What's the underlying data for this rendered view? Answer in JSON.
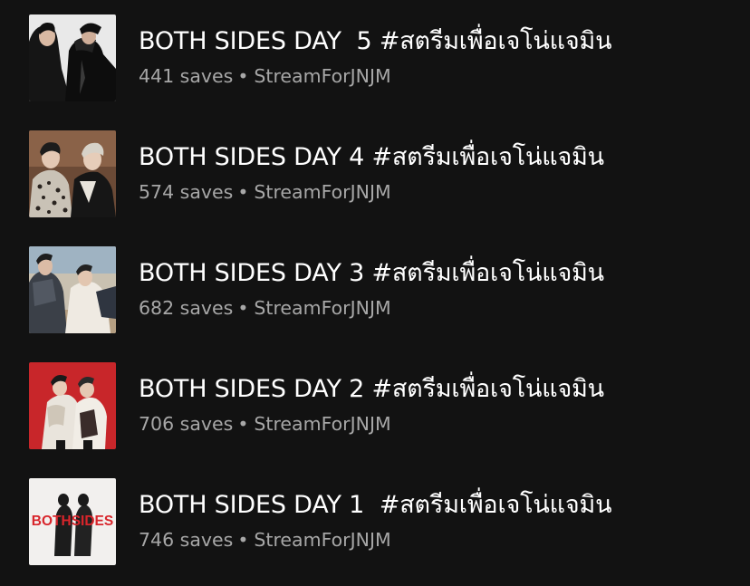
{
  "colors": {
    "background": "#121212",
    "title": "#ffffff",
    "meta": "#a7a7a7"
  },
  "playlists": [
    {
      "title": "BOTH SIDES DAY  5 #สตรีมเพื่อเจโน่แจมิน",
      "saves": "441 saves",
      "separator": "•",
      "owner": "StreamForJNJM",
      "cover": "two-men-black-leather-on-white"
    },
    {
      "title": "BOTH SIDES DAY 4 #สตรีมเพื่อเจโน่แจมิน",
      "saves": "574 saves",
      "separator": "•",
      "owner": "StreamForJNJM",
      "cover": "two-men-leopard-coat-brown-wall"
    },
    {
      "title": "BOTH SIDES DAY 3 #สตรีมเพื่อเจโน่แจมิน",
      "saves": "682 saves",
      "separator": "•",
      "owner": "StreamForJNJM",
      "cover": "two-men-outdoor-desert-sky"
    },
    {
      "title": "BOTH SIDES DAY 2 #สตรีมเพื่อเจโน่แจมิน",
      "saves": "706 saves",
      "separator": "•",
      "owner": "StreamForJNJM",
      "cover": "two-men-fur-coats-red-background"
    },
    {
      "title": "BOTH SIDES DAY 1  #สตรีมเพื่อเจโน่แจมิน",
      "saves": "746 saves",
      "separator": "•",
      "owner": "StreamForJNJM",
      "cover": "bothsides-logo-two-figures-white",
      "cover_text": "BOTHSIDES"
    }
  ]
}
